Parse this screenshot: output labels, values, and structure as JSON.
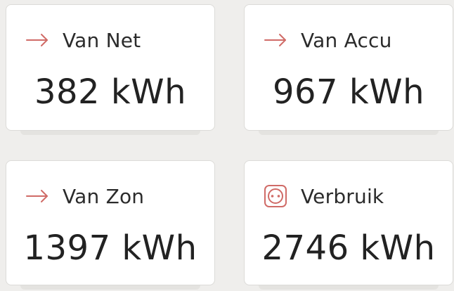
{
  "accent_color": "#d06b67",
  "cards": [
    {
      "label": "Van Net",
      "value": "382 kWh",
      "icon": "arrow-right-icon"
    },
    {
      "label": "Van Accu",
      "value": "967 kWh",
      "icon": "arrow-right-icon"
    },
    {
      "label": "Van Zon",
      "value": "1397 kWh",
      "icon": "arrow-right-icon"
    },
    {
      "label": "Verbruik",
      "value": "2746 kWh",
      "icon": "power-outlet-icon"
    }
  ]
}
